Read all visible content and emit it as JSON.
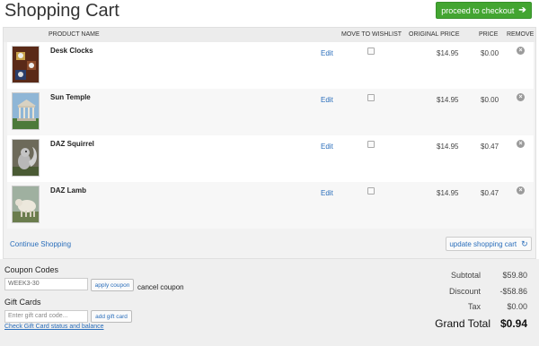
{
  "header": {
    "title": "Shopping Cart",
    "checkout_label": "proceed to checkout"
  },
  "table": {
    "columns": {
      "product": "PRODUCT NAME",
      "wishlist": "MOVE TO WISHLIST",
      "original": "ORIGINAL PRICE",
      "price": "PRICE",
      "remove": "REMOVE"
    },
    "rows": [
      {
        "name": "Desk Clocks",
        "edit": "Edit",
        "original": "$14.95",
        "price": "$0.00",
        "thumb": "desk-clocks",
        "move_to_wishlist": false
      },
      {
        "name": "Sun Temple",
        "edit": "Edit",
        "original": "$14.95",
        "price": "$0.00",
        "thumb": "sun-temple",
        "move_to_wishlist": false
      },
      {
        "name": "DAZ Squirrel",
        "edit": "Edit",
        "original": "$14.95",
        "price": "$0.47",
        "thumb": "daz-squirrel",
        "move_to_wishlist": false
      },
      {
        "name": "DAZ Lamb",
        "edit": "Edit",
        "original": "$14.95",
        "price": "$0.47",
        "thumb": "daz-lamb",
        "move_to_wishlist": false
      }
    ]
  },
  "actions": {
    "continue_label": "Continue Shopping",
    "update_label": "update shopping cart"
  },
  "coupon": {
    "label": "Coupon Codes",
    "value": "WEEK3-30",
    "apply_label": "apply coupon",
    "cancel_label": "cancel coupon"
  },
  "gift": {
    "label": "Gift Cards",
    "placeholder": "Enter gift card code...",
    "add_label": "add gift card",
    "status_link": "Check Gift Card status and balance"
  },
  "totals": {
    "subtotal_label": "Subtotal",
    "subtotal": "$59.80",
    "discount_label": "Discount",
    "discount": "-$58.86",
    "tax_label": "Tax",
    "tax": "$0.00",
    "grand_label": "Grand Total",
    "grand": "$0.94"
  },
  "colors": {
    "accent_green": "#43a531",
    "link_blue": "#2a6ebb"
  },
  "icons": {
    "checkout": "arrow-right-icon",
    "update": "refresh-icon",
    "remove": "remove-x-icon"
  }
}
